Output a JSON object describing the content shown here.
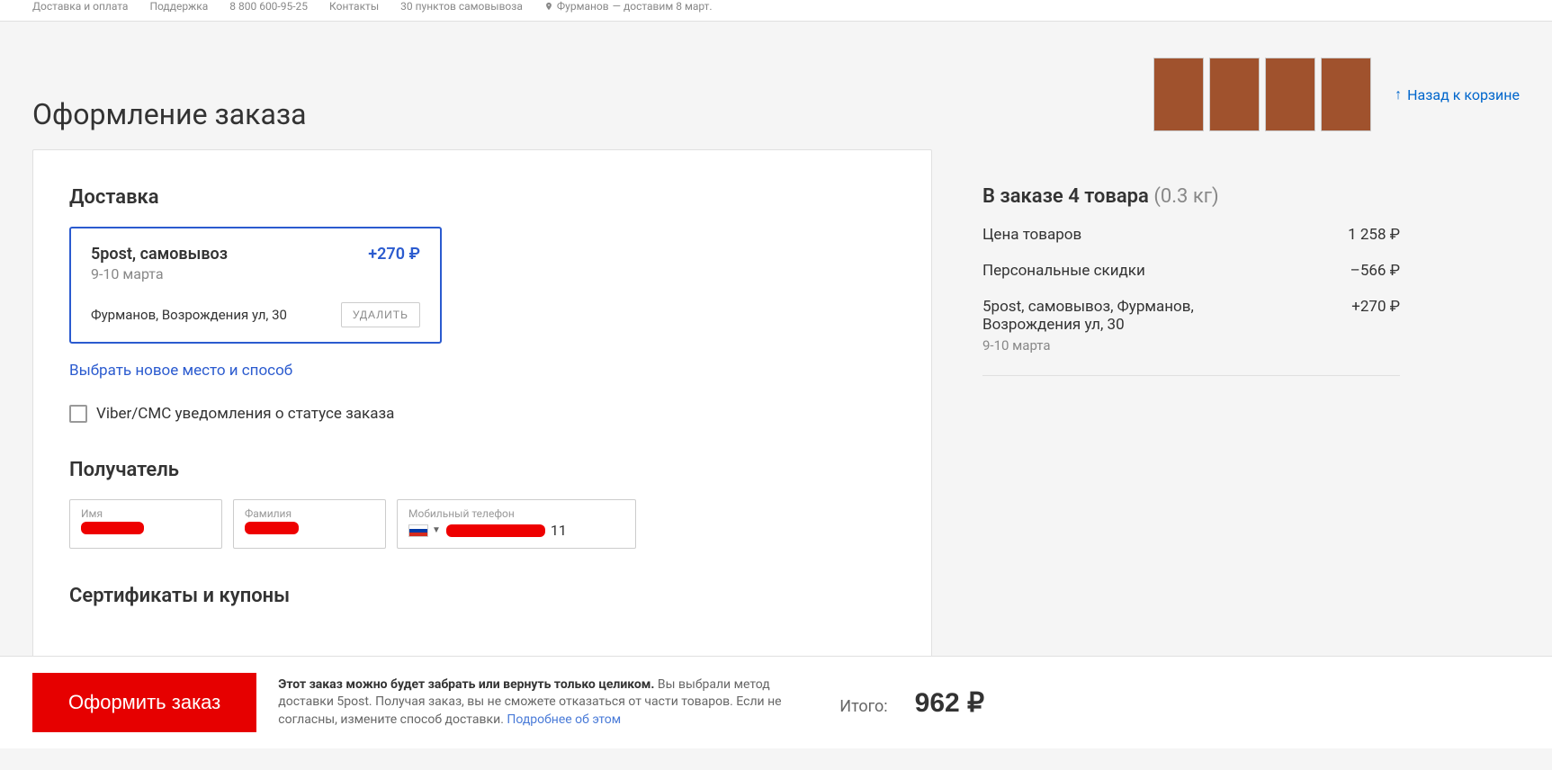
{
  "topbar": {
    "delivery_payment": "Доставка и оплата",
    "support": "Поддержка",
    "phone": "8 800 600-95-25",
    "contacts": "Контакты",
    "pickup": "30 пунктов самовывоза",
    "city": "Фурманов",
    "delivery_note": "— доставим 8 март."
  },
  "header": {
    "title": "Оформление заказа",
    "back": "Назад к корзине"
  },
  "delivery": {
    "heading": "Доставка",
    "method": "5post, самовывоз",
    "price": "+270 ₽",
    "dates": "9-10 марта",
    "address": "Фурманов, Возрождения ул, 30",
    "delete": "УДАЛИТЬ",
    "change_link": "Выбрать новое место и способ",
    "notify": "Viber/СМС уведомления о статусе заказа"
  },
  "recipient": {
    "heading": "Получатель",
    "first_name_label": "Имя",
    "last_name_label": "Фамилия",
    "phone_label": "Мобильный телефон",
    "phone_suffix": "11"
  },
  "cert": {
    "heading": "Сертификаты и купоны"
  },
  "summary": {
    "title_prefix": "В заказе 4 товара",
    "weight": "(0.3 кг)",
    "rows": [
      {
        "label": "Цена товаров",
        "value": "1 258 ₽"
      },
      {
        "label": "Персональные скидки",
        "value": "–566 ₽"
      }
    ],
    "shipping_label": "5post, самовывоз, Фурманов, Возрождения ул, 30",
    "shipping_date": "9-10 марта",
    "shipping_value": "+270 ₽"
  },
  "footer": {
    "submit": "Оформить заказ",
    "note_bold": "Этот заказ можно будет забрать или вернуть только целиком.",
    "note_rest": " Вы выбрали метод доставки 5post. Получая заказ, вы не сможете отказаться от части товаров. Если не согласны, измените способ доставки. ",
    "note_link": "Подробнее об этом",
    "total_label": "Итого:",
    "total_value": "962 ₽"
  }
}
